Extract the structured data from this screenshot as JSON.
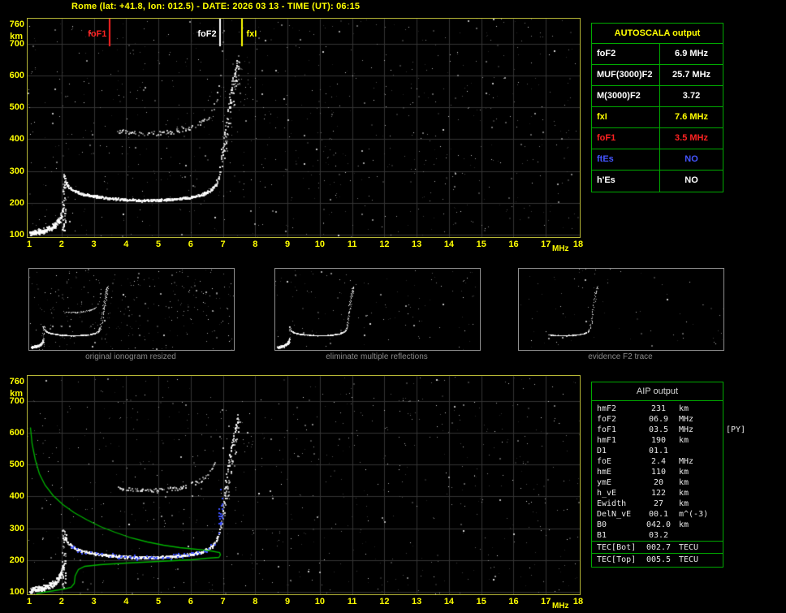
{
  "header": {
    "title": "Rome (lat: +41.8, lon: 012.5) - DATE: 2026 03 13 - TIME (UT): 06:15"
  },
  "colors": {
    "axis_label": "#ffff00",
    "plot_border": "#b6b636",
    "grid": "#353535",
    "table_border": "#00aa00",
    "trace_white": "#ffffff",
    "profile_green": "#00b400",
    "restored_blue": "#3c50ff",
    "fof1_red": "#ff2222",
    "ftes_blue": "#4455ff"
  },
  "axes": {
    "y_unit": "km",
    "x_unit": "MHz",
    "y_ticks": [
      760,
      700,
      600,
      500,
      400,
      300,
      200,
      100
    ],
    "x_ticks": [
      1,
      2,
      3,
      4,
      5,
      6,
      7,
      8,
      9,
      10,
      11,
      12,
      13,
      14,
      15,
      16,
      17,
      18
    ],
    "f_min": 1,
    "f_max": 18,
    "h_min": 100,
    "h_max": 760
  },
  "markers": [
    {
      "label": "foF1",
      "freq_mhz": 3.5,
      "color": "#ff2222",
      "label_side": "left"
    },
    {
      "label": "foF2",
      "freq_mhz": 6.9,
      "color": "#ffffff",
      "label_side": "left"
    },
    {
      "label": "fxI",
      "freq_mhz": 7.6,
      "color": "#ffff00",
      "label_side": "right"
    }
  ],
  "autoscala_table": {
    "title": "AUTOSCALA output",
    "rows": [
      {
        "label": "foF2",
        "value": "6.9 MHz",
        "color": "#ffffff"
      },
      {
        "label": "MUF(3000)F2",
        "value": "25.7 MHz",
        "color": "#ffffff"
      },
      {
        "label": "M(3000)F2",
        "value": "3.72",
        "color": "#ffffff"
      },
      {
        "label": "fxI",
        "value": "7.6 MHz",
        "color": "#ffff00"
      },
      {
        "label": "foF1",
        "value": "3.5 MHz",
        "color": "#ff2222"
      },
      {
        "label": "ftEs",
        "value": "NO",
        "color": "#4455ff"
      },
      {
        "label": "h'Es",
        "value": "NO",
        "color": "#ffffff"
      }
    ]
  },
  "thumbnails": [
    {
      "caption": "original ionogram resized"
    },
    {
      "caption": "eliminate multiple reflections"
    },
    {
      "caption": "evidence F2 trace"
    }
  ],
  "aip_table": {
    "title": "AIP output",
    "rows": [
      {
        "label": "hmF2",
        "value": "231",
        "unit": "km"
      },
      {
        "label": "foF2",
        "value": "06.9",
        "unit": "MHz"
      },
      {
        "label": "foF1",
        "value": "03.5",
        "unit": "MHz",
        "note": "[PY]"
      },
      {
        "label": "hmF1",
        "value": "190",
        "unit": "km"
      },
      {
        "label": "D1",
        "value": "01.1",
        "unit": ""
      },
      {
        "label": "foE",
        "value": "2.4",
        "unit": "MHz"
      },
      {
        "label": "hmE",
        "value": "110",
        "unit": "km"
      },
      {
        "label": "ymE",
        "value": "20",
        "unit": "km"
      },
      {
        "label": "h_vE",
        "value": "122",
        "unit": "km"
      },
      {
        "label": "Ewidth",
        "value": "27",
        "unit": "km"
      },
      {
        "label": "DelN_vE",
        "value": "00.1",
        "unit": "m^(-3)"
      },
      {
        "label": "B0",
        "value": "042.0",
        "unit": "km"
      },
      {
        "label": "B1",
        "value": "03.2",
        "unit": ""
      }
    ],
    "tec_rows": [
      {
        "label": "TEC[Bot]",
        "value": "002.7",
        "unit": "TECU"
      },
      {
        "label": "TEC[Top]",
        "value": "005.5",
        "unit": "TECU"
      }
    ]
  },
  "chart_data": {
    "type": "scatter",
    "title": "Ionogram: virtual height vs sounding frequency, Rome 2026-03-13 06:15 UT",
    "xlabel": "MHz",
    "ylabel": "km",
    "xlim": [
      1,
      18
    ],
    "ylim": [
      100,
      760
    ],
    "grid": true,
    "markers": {
      "foF1_mhz": 3.5,
      "foF2_mhz": 6.9,
      "fxI_mhz": 7.6
    },
    "echo_trace": [
      [
        2.05,
        295
      ],
      [
        2.1,
        272
      ],
      [
        2.2,
        252
      ],
      [
        2.35,
        240
      ],
      [
        2.6,
        230
      ],
      [
        3.0,
        222
      ],
      [
        3.5,
        215
      ],
      [
        4.0,
        211
      ],
      [
        4.5,
        209
      ],
      [
        5.0,
        210
      ],
      [
        5.5,
        213
      ],
      [
        6.0,
        219
      ],
      [
        6.3,
        226
      ],
      [
        6.55,
        237
      ],
      [
        6.7,
        250
      ],
      [
        6.8,
        266
      ],
      [
        6.88,
        292
      ],
      [
        6.95,
        330
      ],
      [
        7.0,
        368
      ],
      [
        7.05,
        415
      ],
      [
        7.1,
        462
      ],
      [
        7.15,
        505
      ],
      [
        7.22,
        548
      ],
      [
        7.3,
        585
      ],
      [
        7.38,
        620
      ],
      [
        7.45,
        650
      ]
    ],
    "e_region": [
      [
        1.0,
        106
      ],
      [
        1.15,
        109
      ],
      [
        1.35,
        113
      ],
      [
        1.55,
        119
      ],
      [
        1.72,
        128
      ],
      [
        1.86,
        141
      ],
      [
        1.95,
        157
      ],
      [
        2.0,
        172
      ],
      [
        2.04,
        195
      ]
    ],
    "second_hop": {
      "f_range": [
        3.7,
        7.0
      ],
      "height_factor": 2
    },
    "f2_spread": {
      "f_range": [
        6.98,
        7.5
      ],
      "h_range": [
        340,
        655
      ]
    },
    "profile_green": [
      [
        1.02,
        618
      ],
      [
        1.08,
        566
      ],
      [
        1.17,
        516
      ],
      [
        1.3,
        472
      ],
      [
        1.48,
        436
      ],
      [
        1.72,
        404
      ],
      [
        2.02,
        376
      ],
      [
        2.38,
        350
      ],
      [
        2.78,
        326
      ],
      [
        3.2,
        306
      ],
      [
        3.65,
        288
      ],
      [
        4.15,
        272
      ],
      [
        4.65,
        259
      ],
      [
        5.15,
        249
      ],
      [
        5.65,
        241
      ],
      [
        6.15,
        234
      ],
      [
        6.6,
        229
      ],
      [
        6.88,
        226
      ],
      [
        6.9,
        218
      ],
      [
        6.85,
        210
      ],
      [
        6.5,
        206
      ],
      [
        6.0,
        202
      ],
      [
        5.0,
        196
      ],
      [
        4.0,
        191
      ],
      [
        3.2,
        186
      ],
      [
        2.7,
        181
      ],
      [
        2.5,
        172
      ],
      [
        2.42,
        150
      ],
      [
        2.38,
        128
      ],
      [
        2.28,
        116
      ],
      [
        2.05,
        110
      ],
      [
        1.75,
        105
      ],
      [
        1.45,
        100
      ],
      [
        1.2,
        95
      ]
    ],
    "restored_trace_blue": {
      "f_range": [
        2.25,
        6.95
      ],
      "follows": "echo_trace"
    }
  }
}
